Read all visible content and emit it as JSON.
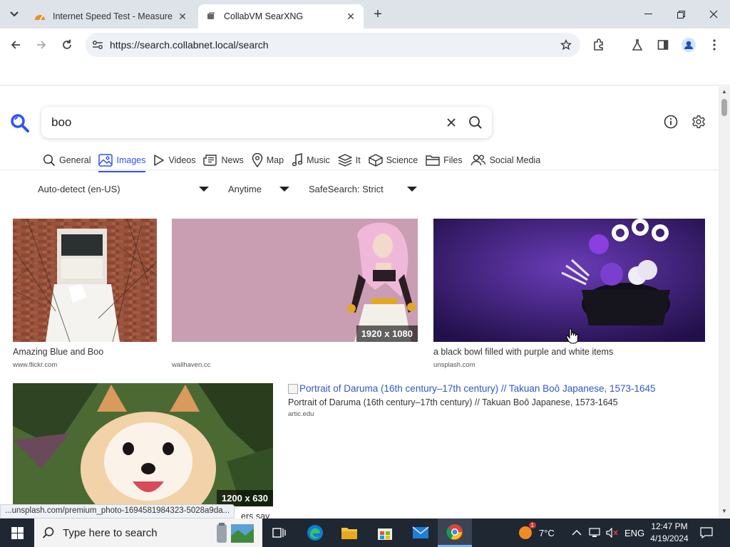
{
  "browser": {
    "tabs": [
      {
        "title": "Internet Speed Test - Measure",
        "active": false
      },
      {
        "title": "CollabVM SearXNG",
        "active": true
      }
    ],
    "url": "https://search.collabnet.local/search",
    "status_url": "...unsplash.com/premium_photo-1694581984323-5028a9da..."
  },
  "search": {
    "query": "boo"
  },
  "categories": [
    {
      "label": "General",
      "icon": "search-icon"
    },
    {
      "label": "Images",
      "icon": "image-icon",
      "active": true
    },
    {
      "label": "Videos",
      "icon": "play-icon"
    },
    {
      "label": "News",
      "icon": "newspaper-icon"
    },
    {
      "label": "Map",
      "icon": "map-pin-icon"
    },
    {
      "label": "Music",
      "icon": "music-icon"
    },
    {
      "label": "It",
      "icon": "layers-icon"
    },
    {
      "label": "Science",
      "icon": "cube-icon"
    },
    {
      "label": "Files",
      "icon": "folder-icon"
    },
    {
      "label": "Social Media",
      "icon": "people-icon"
    }
  ],
  "filters": {
    "language": "Auto-detect (en-US)",
    "time": "Anytime",
    "safesearch": "SafeSearch: Strict"
  },
  "results": [
    {
      "caption": "Amazing Blue and Boo",
      "source": "www.flickr.com",
      "resolution": ""
    },
    {
      "caption": "",
      "source": "wallhaven.cc",
      "resolution": "1920 x 1080"
    },
    {
      "caption": "a black bowl filled with purple and white items",
      "source": "unsplash.com",
      "resolution": ""
    },
    {
      "caption": "ers say",
      "source": "",
      "resolution": "1200 x 630"
    }
  ],
  "broken_result": {
    "alt": "Portrait of Daruma (16th century–17th century) // Takuan Boô Japanese, 1573-1645",
    "caption": "Portrait of Daruma (16th century–17th century) // Takuan Boô Japanese, 1573-1645",
    "source": "artic.edu"
  },
  "taskbar": {
    "search_placeholder": "Type here to search",
    "weather": "7°C",
    "language": "ENG",
    "time": "12:47 PM",
    "date": "4/19/2024",
    "weather_badge": "1"
  },
  "colors": {
    "accent": "#3050ff",
    "taskbar": "#1f2733",
    "tabbar": "#dee3ea"
  }
}
